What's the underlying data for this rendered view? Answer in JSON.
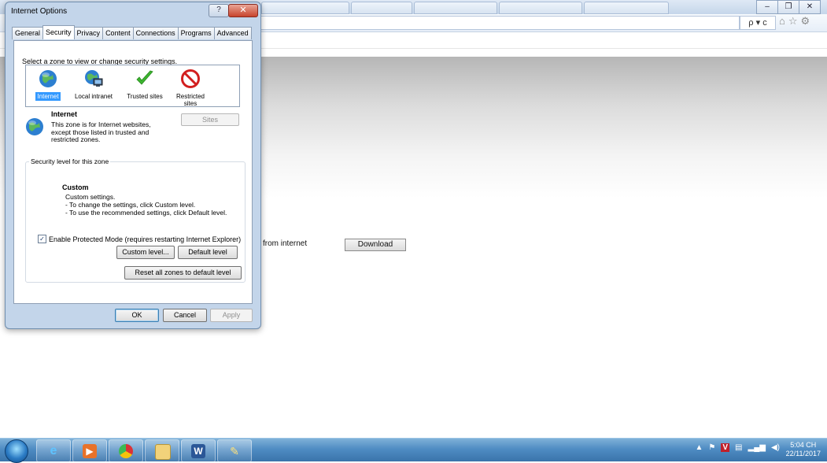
{
  "dialog": {
    "title": "Internet Options",
    "help_label": "?",
    "close_label": "✕",
    "tabs": [
      {
        "label": "General",
        "active": false
      },
      {
        "label": "Security",
        "active": true
      },
      {
        "label": "Privacy",
        "active": false
      },
      {
        "label": "Content",
        "active": false
      },
      {
        "label": "Connections",
        "active": false
      },
      {
        "label": "Programs",
        "active": false
      },
      {
        "label": "Advanced",
        "active": false
      }
    ],
    "zone_prompt": "Select a zone to view or change security settings.",
    "zones": [
      {
        "label": "Internet",
        "icon": "globe-icon",
        "selected": true
      },
      {
        "label": "Local intranet",
        "icon": "intranet-icon",
        "selected": false
      },
      {
        "label": "Trusted sites",
        "icon": "checkmark-icon",
        "selected": false
      },
      {
        "label": "Restricted sites",
        "icon": "restricted-icon",
        "selected": false
      }
    ],
    "zone_info": {
      "name": "Internet",
      "description": "This zone is for Internet websites, except those listed in trusted and restricted zones."
    },
    "sites_button": "Sites",
    "security_level": {
      "legend": "Security level for this zone",
      "title": "Custom",
      "lines": [
        "Custom settings.",
        "- To change the settings, click Custom level.",
        "- To use the recommended settings, click Default level."
      ]
    },
    "protected_mode": {
      "label": "Enable Protected Mode (requires restarting Internet Explorer)",
      "checked": true
    },
    "custom_level_button": "Custom level...",
    "default_level_button": "Default level",
    "reset_button": "Reset all zones to default level",
    "ok_button": "OK",
    "cancel_button": "Cancel",
    "apply_button": "Apply"
  },
  "page": {
    "from_internet_text": "from internet",
    "download_button": "Download"
  },
  "browser": {
    "search_symbol": "ρ ▾ c",
    "toolbar_icons": [
      "home-icon",
      "favorites-star-icon",
      "settings-gear-icon"
    ],
    "window_buttons": [
      "minimize",
      "restore",
      "close"
    ]
  },
  "taskbar": {
    "apps": [
      "internet-explorer",
      "media-player",
      "chrome",
      "file-explorer",
      "word",
      "paint"
    ],
    "clock_time": "5:04 CH",
    "clock_date": "22/11/2017"
  },
  "colors": {
    "selection": "#3399ff",
    "dialog_frame": "#c3d5ea",
    "taskbar": "#4f8cc3"
  }
}
